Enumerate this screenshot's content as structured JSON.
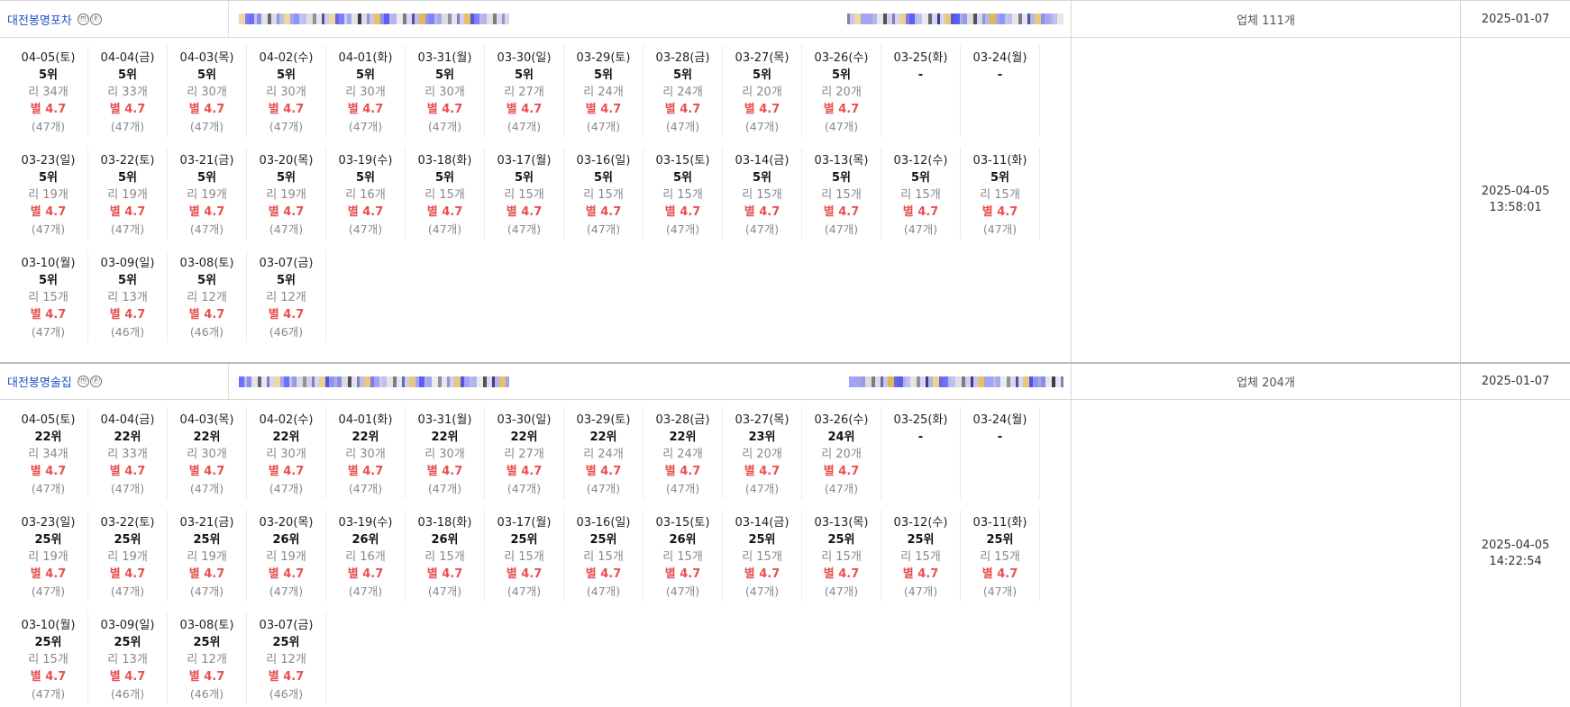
{
  "rows": [
    {
      "keyword": "대전봉명포차",
      "icon_m": "ⓜ",
      "icon_p": "ⓟ",
      "business_count": "업체 111개",
      "start_date": "2025-01-07",
      "updated_date": "2025-04-05",
      "updated_time": "13:58:01",
      "days": [
        {
          "date": "04-05(토)",
          "rank": "5위",
          "reviews": "리 34개",
          "star": "별 4.7",
          "count": "(47개)"
        },
        {
          "date": "04-04(금)",
          "rank": "5위",
          "reviews": "리 33개",
          "star": "별 4.7",
          "count": "(47개)"
        },
        {
          "date": "04-03(목)",
          "rank": "5위",
          "reviews": "리 30개",
          "star": "별 4.7",
          "count": "(47개)"
        },
        {
          "date": "04-02(수)",
          "rank": "5위",
          "reviews": "리 30개",
          "star": "별 4.7",
          "count": "(47개)"
        },
        {
          "date": "04-01(화)",
          "rank": "5위",
          "reviews": "리 30개",
          "star": "별 4.7",
          "count": "(47개)"
        },
        {
          "date": "03-31(월)",
          "rank": "5위",
          "reviews": "리 30개",
          "star": "별 4.7",
          "count": "(47개)"
        },
        {
          "date": "03-30(일)",
          "rank": "5위",
          "reviews": "리 27개",
          "star": "별 4.7",
          "count": "(47개)"
        },
        {
          "date": "03-29(토)",
          "rank": "5위",
          "reviews": "리 24개",
          "star": "별 4.7",
          "count": "(47개)"
        },
        {
          "date": "03-28(금)",
          "rank": "5위",
          "reviews": "리 24개",
          "star": "별 4.7",
          "count": "(47개)"
        },
        {
          "date": "03-27(목)",
          "rank": "5위",
          "reviews": "리 20개",
          "star": "별 4.7",
          "count": "(47개)"
        },
        {
          "date": "03-26(수)",
          "rank": "5위",
          "reviews": "리 20개",
          "star": "별 4.7",
          "count": "(47개)"
        },
        {
          "date": "03-25(화)",
          "rank": "-",
          "reviews": "",
          "star": "",
          "count": ""
        },
        {
          "date": "03-24(월)",
          "rank": "-",
          "reviews": "",
          "star": "",
          "count": ""
        },
        {
          "date": "03-23(일)",
          "rank": "5위",
          "reviews": "리 19개",
          "star": "별 4.7",
          "count": "(47개)"
        },
        {
          "date": "03-22(토)",
          "rank": "5위",
          "reviews": "리 19개",
          "star": "별 4.7",
          "count": "(47개)"
        },
        {
          "date": "03-21(금)",
          "rank": "5위",
          "reviews": "리 19개",
          "star": "별 4.7",
          "count": "(47개)"
        },
        {
          "date": "03-20(목)",
          "rank": "5위",
          "reviews": "리 19개",
          "star": "별 4.7",
          "count": "(47개)"
        },
        {
          "date": "03-19(수)",
          "rank": "5위",
          "reviews": "리 16개",
          "star": "별 4.7",
          "count": "(47개)"
        },
        {
          "date": "03-18(화)",
          "rank": "5위",
          "reviews": "리 15개",
          "star": "별 4.7",
          "count": "(47개)"
        },
        {
          "date": "03-17(월)",
          "rank": "5위",
          "reviews": "리 15개",
          "star": "별 4.7",
          "count": "(47개)"
        },
        {
          "date": "03-16(일)",
          "rank": "5위",
          "reviews": "리 15개",
          "star": "별 4.7",
          "count": "(47개)"
        },
        {
          "date": "03-15(토)",
          "rank": "5위",
          "reviews": "리 15개",
          "star": "별 4.7",
          "count": "(47개)"
        },
        {
          "date": "03-14(금)",
          "rank": "5위",
          "reviews": "리 15개",
          "star": "별 4.7",
          "count": "(47개)"
        },
        {
          "date": "03-13(목)",
          "rank": "5위",
          "reviews": "리 15개",
          "star": "별 4.7",
          "count": "(47개)"
        },
        {
          "date": "03-12(수)",
          "rank": "5위",
          "reviews": "리 15개",
          "star": "별 4.7",
          "count": "(47개)"
        },
        {
          "date": "03-11(화)",
          "rank": "5위",
          "reviews": "리 15개",
          "star": "별 4.7",
          "count": "(47개)"
        },
        {
          "date": "03-10(월)",
          "rank": "5위",
          "reviews": "리 15개",
          "star": "별 4.7",
          "count": "(47개)"
        },
        {
          "date": "03-09(일)",
          "rank": "5위",
          "reviews": "리 13개",
          "star": "별 4.7",
          "count": "(46개)"
        },
        {
          "date": "03-08(토)",
          "rank": "5위",
          "reviews": "리 12개",
          "star": "별 4.7",
          "count": "(46개)"
        },
        {
          "date": "03-07(금)",
          "rank": "5위",
          "reviews": "리 12개",
          "star": "별 4.7",
          "count": "(46개)"
        }
      ]
    },
    {
      "keyword": "대전봉명술집",
      "icon_m": "ⓜ",
      "icon_p": "ⓟ",
      "business_count": "업체 204개",
      "start_date": "2025-01-07",
      "updated_date": "2025-04-05",
      "updated_time": "14:22:54",
      "days": [
        {
          "date": "04-05(토)",
          "rank": "22위",
          "reviews": "리 34개",
          "star": "별 4.7",
          "count": "(47개)"
        },
        {
          "date": "04-04(금)",
          "rank": "22위",
          "reviews": "리 33개",
          "star": "별 4.7",
          "count": "(47개)"
        },
        {
          "date": "04-03(목)",
          "rank": "22위",
          "reviews": "리 30개",
          "star": "별 4.7",
          "count": "(47개)"
        },
        {
          "date": "04-02(수)",
          "rank": "22위",
          "reviews": "리 30개",
          "star": "별 4.7",
          "count": "(47개)"
        },
        {
          "date": "04-01(화)",
          "rank": "22위",
          "reviews": "리 30개",
          "star": "별 4.7",
          "count": "(47개)"
        },
        {
          "date": "03-31(월)",
          "rank": "22위",
          "reviews": "리 30개",
          "star": "별 4.7",
          "count": "(47개)"
        },
        {
          "date": "03-30(일)",
          "rank": "22위",
          "reviews": "리 27개",
          "star": "별 4.7",
          "count": "(47개)"
        },
        {
          "date": "03-29(토)",
          "rank": "22위",
          "reviews": "리 24개",
          "star": "별 4.7",
          "count": "(47개)"
        },
        {
          "date": "03-28(금)",
          "rank": "22위",
          "reviews": "리 24개",
          "star": "별 4.7",
          "count": "(47개)"
        },
        {
          "date": "03-27(목)",
          "rank": "23위",
          "reviews": "리 20개",
          "star": "별 4.7",
          "count": "(47개)"
        },
        {
          "date": "03-26(수)",
          "rank": "24위",
          "reviews": "리 20개",
          "star": "별 4.7",
          "count": "(47개)"
        },
        {
          "date": "03-25(화)",
          "rank": "-",
          "reviews": "",
          "star": "",
          "count": ""
        },
        {
          "date": "03-24(월)",
          "rank": "-",
          "reviews": "",
          "star": "",
          "count": ""
        },
        {
          "date": "03-23(일)",
          "rank": "25위",
          "reviews": "리 19개",
          "star": "별 4.7",
          "count": "(47개)"
        },
        {
          "date": "03-22(토)",
          "rank": "25위",
          "reviews": "리 19개",
          "star": "별 4.7",
          "count": "(47개)"
        },
        {
          "date": "03-21(금)",
          "rank": "25위",
          "reviews": "리 19개",
          "star": "별 4.7",
          "count": "(47개)"
        },
        {
          "date": "03-20(목)",
          "rank": "26위",
          "reviews": "리 19개",
          "star": "별 4.7",
          "count": "(47개)"
        },
        {
          "date": "03-19(수)",
          "rank": "26위",
          "reviews": "리 16개",
          "star": "별 4.7",
          "count": "(47개)"
        },
        {
          "date": "03-18(화)",
          "rank": "26위",
          "reviews": "리 15개",
          "star": "별 4.7",
          "count": "(47개)"
        },
        {
          "date": "03-17(월)",
          "rank": "25위",
          "reviews": "리 15개",
          "star": "별 4.7",
          "count": "(47개)"
        },
        {
          "date": "03-16(일)",
          "rank": "25위",
          "reviews": "리 15개",
          "star": "별 4.7",
          "count": "(47개)"
        },
        {
          "date": "03-15(토)",
          "rank": "26위",
          "reviews": "리 15개",
          "star": "별 4.7",
          "count": "(47개)"
        },
        {
          "date": "03-14(금)",
          "rank": "25위",
          "reviews": "리 15개",
          "star": "별 4.7",
          "count": "(47개)"
        },
        {
          "date": "03-13(목)",
          "rank": "25위",
          "reviews": "리 15개",
          "star": "별 4.7",
          "count": "(47개)"
        },
        {
          "date": "03-12(수)",
          "rank": "25위",
          "reviews": "리 15개",
          "star": "별 4.7",
          "count": "(47개)"
        },
        {
          "date": "03-11(화)",
          "rank": "25위",
          "reviews": "리 15개",
          "star": "별 4.7",
          "count": "(47개)"
        },
        {
          "date": "03-10(월)",
          "rank": "25위",
          "reviews": "리 15개",
          "star": "별 4.7",
          "count": "(47개)"
        },
        {
          "date": "03-09(일)",
          "rank": "25위",
          "reviews": "리 13개",
          "star": "별 4.7",
          "count": "(46개)"
        },
        {
          "date": "03-08(토)",
          "rank": "25위",
          "reviews": "리 12개",
          "star": "별 4.7",
          "count": "(46개)"
        },
        {
          "date": "03-07(금)",
          "rank": "25위",
          "reviews": "리 12개",
          "star": "별 4.7",
          "count": "(46개)"
        }
      ]
    }
  ],
  "colors": {
    "keyword_link": "#2250c8",
    "star": "#e85050",
    "muted": "#888888"
  }
}
